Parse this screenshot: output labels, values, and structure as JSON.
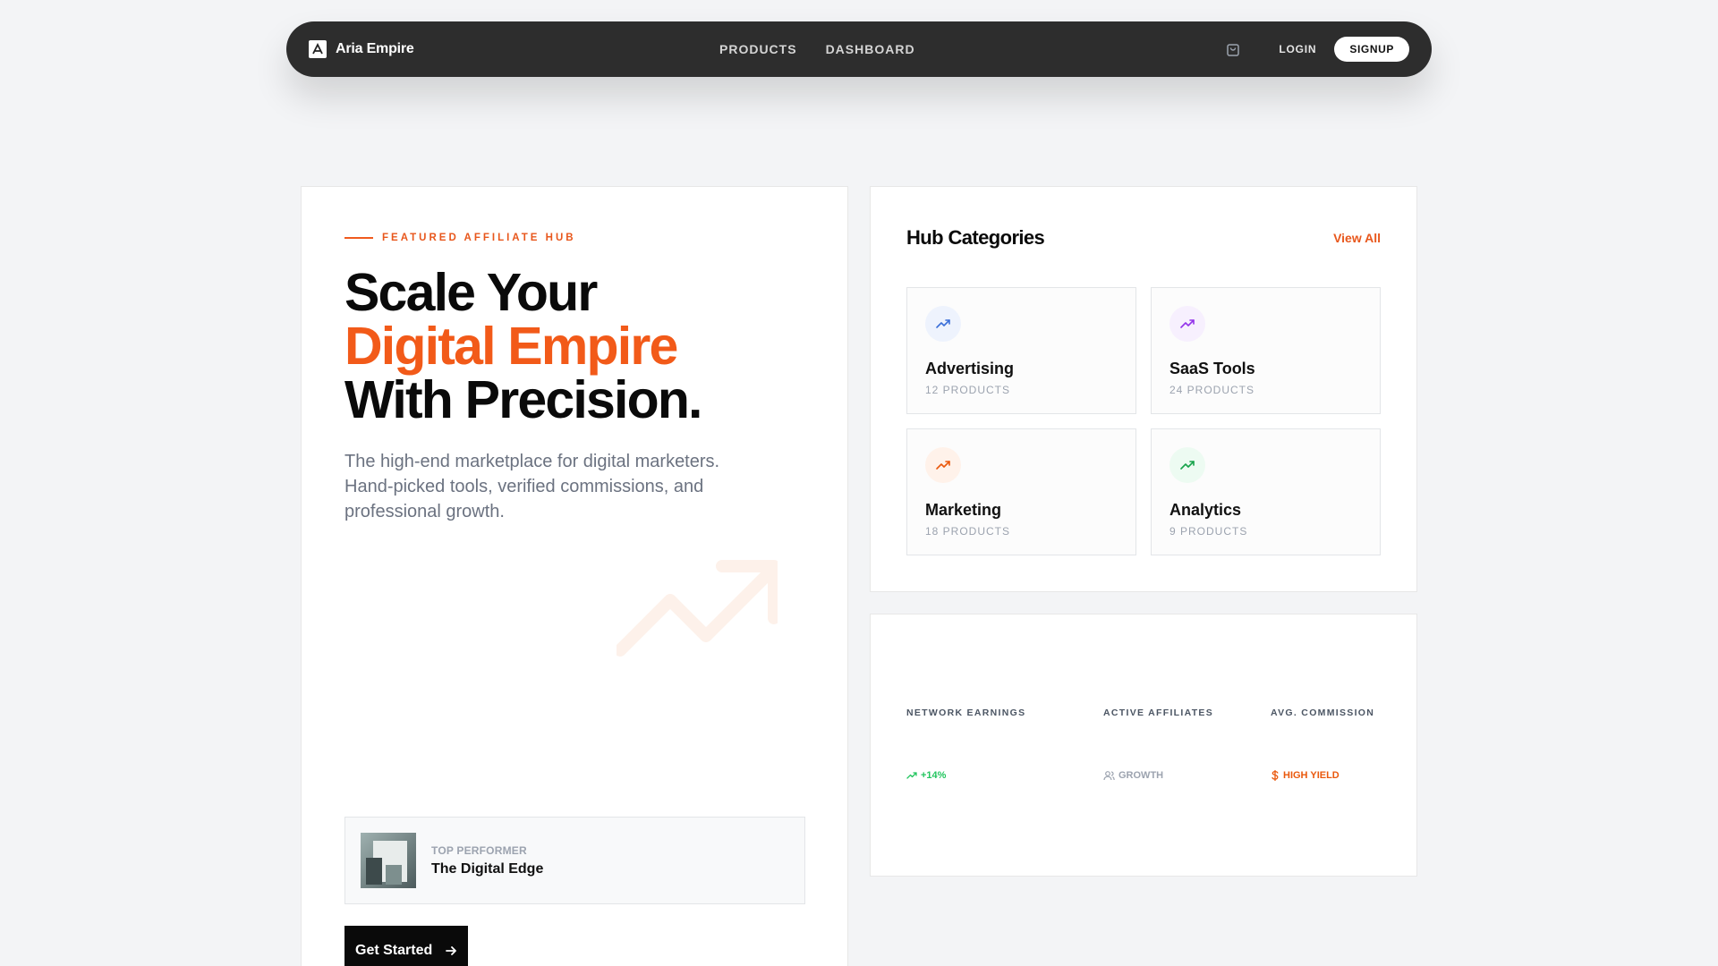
{
  "nav": {
    "brand": "Aria Empire",
    "links": [
      "PRODUCTS",
      "DASHBOARD"
    ],
    "login": "LOGIN",
    "signup": "SIGNUP"
  },
  "hero": {
    "eyebrow": "FEATURED AFFILIATE HUB",
    "title_line1": "Scale Your",
    "title_line2": "Digital Empire",
    "title_line3": "With Precision.",
    "description": "The high-end marketplace for digital marketers. Hand-picked tools, verified commissions, and professional growth.",
    "top_performer_label": "TOP PERFORMER",
    "top_performer_title": "The Digital Edge",
    "cta": "Get Started"
  },
  "categories": {
    "title": "Hub Categories",
    "view_all": "View All",
    "items": [
      {
        "name": "Advertising",
        "count": "12 PRODUCTS",
        "icon": "trending-up-icon",
        "color": "#3b6fd8",
        "bg": "#eef3fd"
      },
      {
        "name": "SaaS Tools",
        "count": "24 PRODUCTS",
        "icon": "trending-up-icon",
        "color": "#9333ea",
        "bg": "#f7f0fe"
      },
      {
        "name": "Marketing",
        "count": "18 PRODUCTS",
        "icon": "trending-up-icon",
        "color": "#ea580c",
        "bg": "#fff2ea"
      },
      {
        "name": "Analytics",
        "count": "9 PRODUCTS",
        "icon": "trending-up-icon",
        "color": "#16a34a",
        "bg": "#edfbf2"
      }
    ]
  },
  "stats": {
    "items": [
      {
        "label": "NETWORK EARNINGS",
        "sub": "+14%",
        "sub_color": "#22c55e",
        "icon": "trending-up-icon"
      },
      {
        "label": "ACTIVE AFFILIATES",
        "sub": "GROWTH",
        "sub_color": "#9ca3af",
        "icon": "users-icon"
      },
      {
        "label": "AVG. COMMISSION",
        "sub": "HIGH YIELD",
        "sub_color": "#ea580c",
        "icon": "dollar-icon"
      }
    ]
  },
  "colors": {
    "accent": "#f25a19",
    "nav_bg": "#2d2d2d"
  }
}
